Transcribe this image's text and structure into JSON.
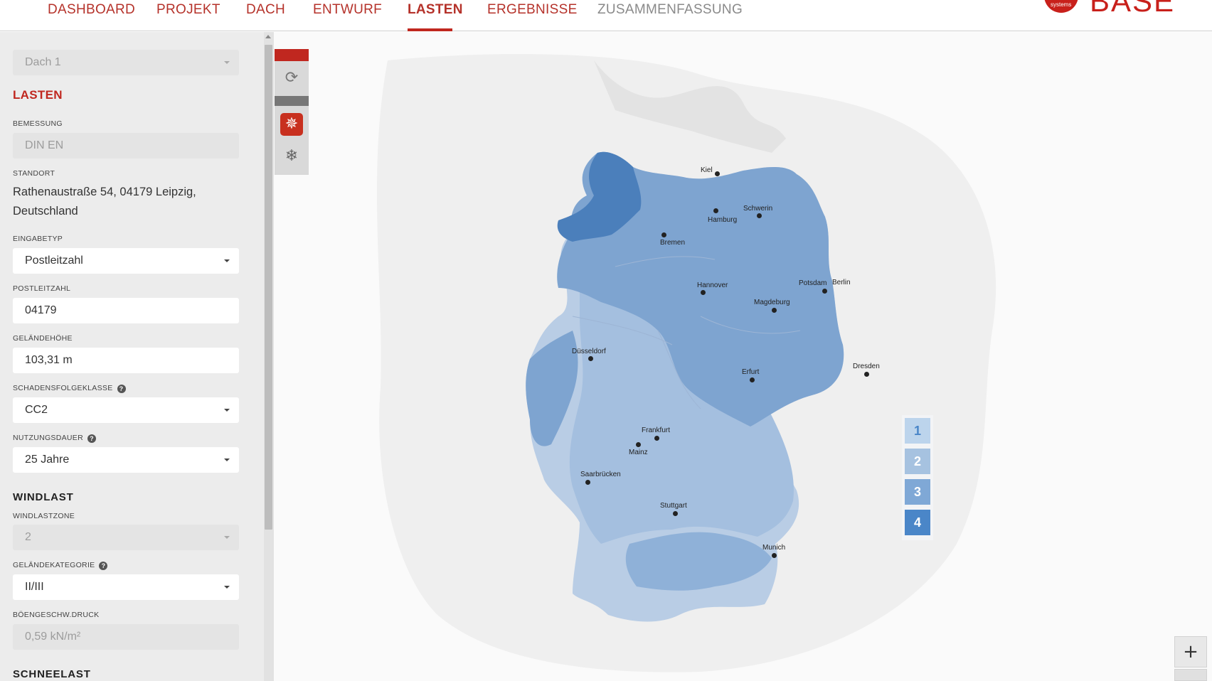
{
  "nav": {
    "tabs": [
      {
        "label": "DASHBOARD"
      },
      {
        "label": "PROJEKT"
      },
      {
        "label": "DACH"
      },
      {
        "label": "ENTWURF"
      },
      {
        "label": "LASTEN"
      },
      {
        "label": "ERGEBNISSE"
      },
      {
        "label": "ZUSAMMENFASSUNG"
      }
    ],
    "active_tab": "LASTEN",
    "brand_text": "BASE",
    "logo_small": "systems"
  },
  "sidebar": {
    "roof_select": "Dach 1",
    "section_title": "LASTEN",
    "bemessung": {
      "label": "BEMESSUNG",
      "value": "DIN EN"
    },
    "standort": {
      "label": "STANDORT",
      "value": "Rathenaustraße 54, 04179 Leipzig, Deutschland"
    },
    "eingabetyp": {
      "label": "EINGABETYP",
      "value": "Postleitzahl"
    },
    "postleitzahl": {
      "label": "POSTLEITZAHL",
      "value": "04179"
    },
    "gelaendehoehe": {
      "label": "GELÄNDEHÖHE",
      "value": "103,31 m"
    },
    "schadensfolgeklasse": {
      "label": "SCHADENSFOLGEKLASSE",
      "value": "CC2"
    },
    "nutzungsdauer": {
      "label": "NUTZUNGSDAUER",
      "value": "25 Jahre"
    },
    "windlast_title": "WINDLAST",
    "windlastzone": {
      "label": "WINDLASTZONE",
      "value": "2"
    },
    "gelaendekategorie": {
      "label": "GELÄNDEKATEGORIE",
      "value": "II/III"
    },
    "boengeschw": {
      "label": "BÖENGESCHW.DRUCK",
      "value": "0,59 kN/m²"
    },
    "schneelast_title": "SCHNEELAST",
    "help_glyph": "?"
  },
  "tools": {
    "refresh_icon": "refresh-icon",
    "wind_icon": "pinwheel-icon",
    "snow_icon": "snowflake-icon"
  },
  "legend": {
    "items": [
      {
        "label": "1",
        "color": "#bcd4ec"
      },
      {
        "label": "2",
        "color": "#a6c2e0"
      },
      {
        "label": "3",
        "color": "#7fa8d6"
      },
      {
        "label": "4",
        "color": "#4a86c8"
      }
    ]
  },
  "map": {
    "cities": [
      {
        "name": "Kiel"
      },
      {
        "name": "Schwerin"
      },
      {
        "name": "Hamburg"
      },
      {
        "name": "Bremen"
      },
      {
        "name": "Hannover"
      },
      {
        "name": "Potsdam"
      },
      {
        "name": "Berlin"
      },
      {
        "name": "Magdeburg"
      },
      {
        "name": "Düsseldorf"
      },
      {
        "name": "Erfurt"
      },
      {
        "name": "Dresden"
      },
      {
        "name": "Frankfurt"
      },
      {
        "name": "Mainz"
      },
      {
        "name": "Saarbrücken"
      },
      {
        "name": "Stuttgart"
      },
      {
        "name": "Munich"
      }
    ]
  },
  "zoom": {
    "plus": "+"
  }
}
